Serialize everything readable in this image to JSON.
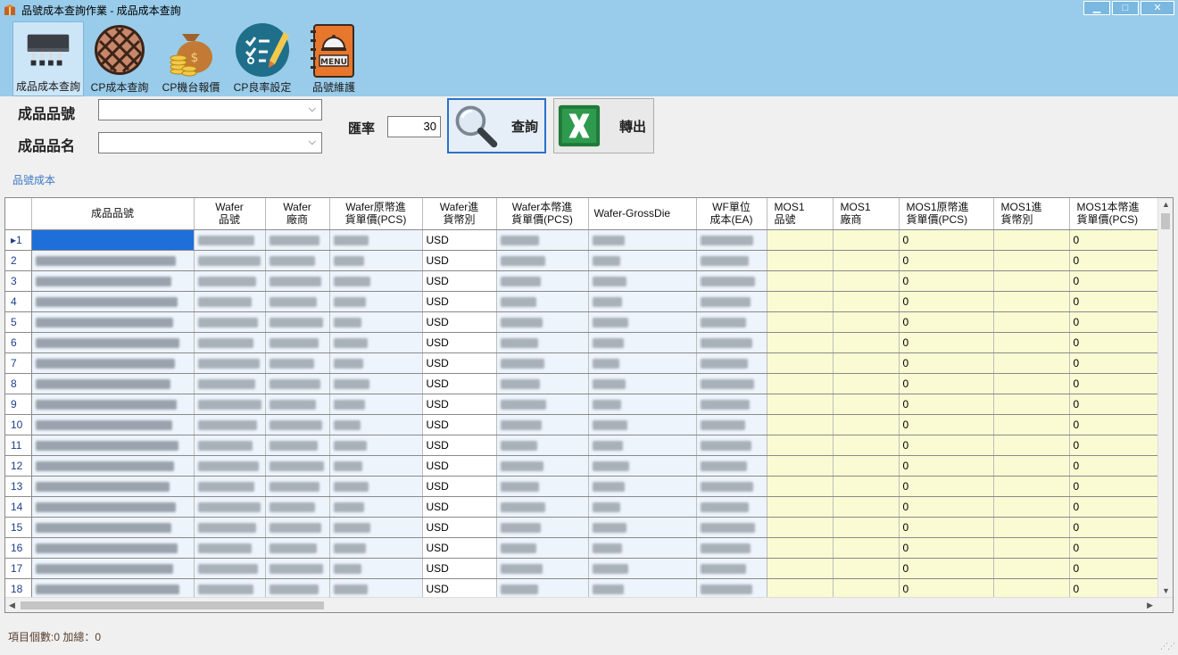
{
  "window": {
    "title": "品號成本查詢作業 - 成品成本查詢",
    "min_label": "▁",
    "max_label": "□",
    "close_label": "✕"
  },
  "toolbar": {
    "items": [
      {
        "label": "成品成本查詢",
        "icon": "chip-icon",
        "active": true
      },
      {
        "label": "CP成本查詢",
        "icon": "wafer-icon",
        "active": false
      },
      {
        "label": "CP機台報價",
        "icon": "money-bag-icon",
        "active": false
      },
      {
        "label": "CP良率設定",
        "icon": "checklist-icon",
        "active": false
      },
      {
        "label": "品號維護",
        "icon": "menu-book-icon",
        "active": false
      }
    ]
  },
  "filters": {
    "part_no_label": "成品品號",
    "part_no_value": "",
    "part_name_label": "成品品名",
    "part_name_value": "",
    "rate_label": "匯率",
    "rate_value": "30",
    "query_label": "查詢",
    "export_label": "轉出"
  },
  "tab_label": "品號成本",
  "grid": {
    "columns": [
      "成品品號",
      "Wafer\n品號",
      "Wafer\n廠商",
      "Wafer原幣進\n貨單價(PCS)",
      "Wafer進\n貨幣別",
      "Wafer本幣進\n貨單價(PCS)",
      "Wafer-GrossDie",
      "WF單位\n成本(EA)",
      "MOS1\n品號",
      "MOS1\n廠商",
      "MOS1原幣進\n貨單價(PCS)",
      "MOS1進\n貨幣別",
      "MOS1本幣進\n貨單價(PCS)"
    ],
    "row_numbers": [
      "1",
      "2",
      "3",
      "4",
      "5",
      "6",
      "7",
      "8",
      "9",
      "10",
      "11",
      "12",
      "13",
      "14",
      "15",
      "16",
      "17",
      "18"
    ],
    "currency": "USD",
    "zero": "0"
  },
  "status": {
    "text": "項目個數:0   加總：0"
  },
  "colors": {
    "title_bar": "#99ccea",
    "selection": "#1e6fd9",
    "blue_cell": "#eef4fb",
    "yellow_cell": "#fafbd3"
  }
}
